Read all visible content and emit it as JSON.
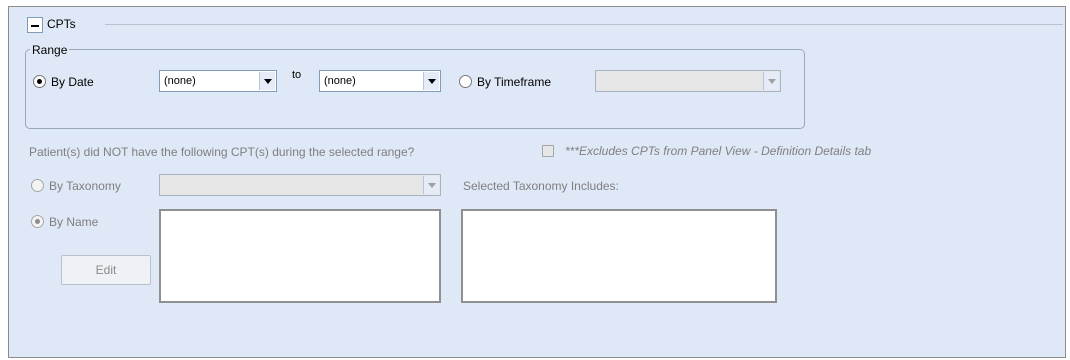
{
  "group": {
    "title": "CPTs",
    "collapse_symbol": "−"
  },
  "range": {
    "label": "Range",
    "by_date_label": "By Date",
    "from_value": "(none)",
    "to_label": "to",
    "to_value": "(none)",
    "by_timeframe_label": "By Timeframe",
    "timeframe_value": ""
  },
  "question": {
    "text": "Patient(s) did NOT  have the following CPT(s) during the selected range?",
    "excludes_note": "***Excludes CPTs from Panel View - Definition Details tab"
  },
  "taxonomy": {
    "by_taxonomy_label": "By Taxonomy",
    "taxonomy_value": "",
    "selected_includes_label": "Selected Taxonomy Includes:"
  },
  "by_name": {
    "label": "By Name",
    "edit_button": "Edit"
  },
  "colors": {
    "panel_bg": "#dfe8f6",
    "border": "#8c8c8c"
  }
}
